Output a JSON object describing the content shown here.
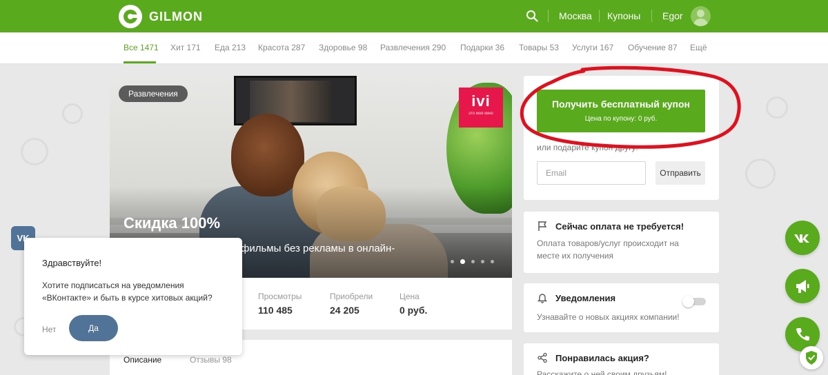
{
  "header": {
    "logo_text": "GILMON",
    "city": "Москва",
    "coupons": "Купоны",
    "user": "Egor"
  },
  "categories": [
    {
      "label": "Все 1471",
      "active": true
    },
    {
      "label": "Хит 171"
    },
    {
      "label": "Еда 213"
    },
    {
      "label": "Красота 287"
    },
    {
      "label": "Здоровье 98"
    },
    {
      "label": "Развлечения 290"
    },
    {
      "label": "Подарки 36"
    },
    {
      "label": "Товары 53"
    },
    {
      "label": "Услуги 167"
    },
    {
      "label": "Обучение 87"
    },
    {
      "label": "Ещё"
    }
  ],
  "deal": {
    "category_badge": "Развлечения",
    "brand_word": "ivi",
    "brand_tagline": "это моё кино",
    "discount": "Скидка 100%",
    "description": "фильмы без рекламы в онлайн-",
    "slide_count": 5,
    "active_slide": 2
  },
  "stats": [
    {
      "label": "Просмотры",
      "value": "110 485"
    },
    {
      "label": "Приобрели",
      "value": "24 205"
    },
    {
      "label": "Цена",
      "value": "0 руб."
    }
  ],
  "tabs": {
    "description": "Описание",
    "reviews": "Отзывы 98"
  },
  "coupon": {
    "button_title": "Получить бесплатный купон",
    "button_sub": "Цена по купону: 0 руб.",
    "gift_text": "или подарите купон другу:",
    "email_placeholder": "Email",
    "send_label": "Отправить"
  },
  "payment": {
    "title": "Сейчас оплата не требуется!",
    "text": "Оплата товаров/услуг происходит на месте их получения"
  },
  "notifications": {
    "title": "Уведомления",
    "text": "Узнавайте о новых акциях компании!",
    "enabled": false
  },
  "share": {
    "title": "Понравилась акция?",
    "text": "Расскажите о ней своим друзьям!"
  },
  "vk_popup": {
    "tab_label": "VK",
    "title": "Здравствуйте!",
    "text": "Хотите подписаться на уведомления «ВКонтакте» и быть в курсе хитовых акций?",
    "no_label": "Нет",
    "yes_label": "Да"
  },
  "colors": {
    "brand_green": "#5aaa1e",
    "vk_blue": "#517397",
    "ivi_red": "#e8174b",
    "annotation_red": "#e0101e"
  }
}
